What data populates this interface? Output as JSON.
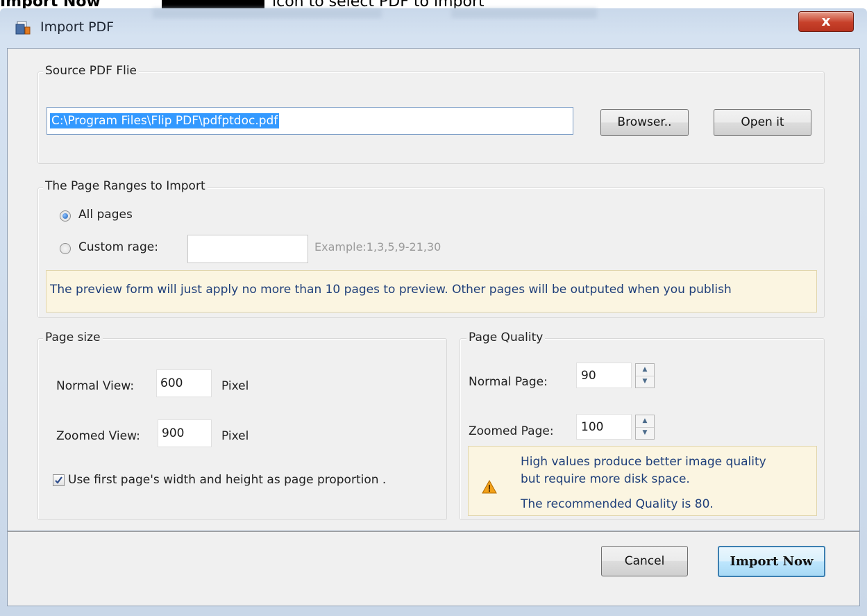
{
  "background": {
    "bold_text": "Import Now",
    "caption": "icon to select PDF to import"
  },
  "window": {
    "title": "Import PDF",
    "close_label": "x"
  },
  "source": {
    "legend": "Source PDF Flie",
    "path_value": "C:\\Program Files\\Flip PDF\\pdfptdoc.pdf",
    "browse_label": "Browser..",
    "open_label": "Open it"
  },
  "ranges": {
    "legend": "The Page Ranges to Import",
    "all_pages_label": "All pages",
    "all_pages_selected": true,
    "custom_label": "Custom rage:",
    "custom_value": "",
    "example_text": "Example:1,3,5,9-21,30",
    "info_text": "The preview form will just apply no more than 10 pages to preview. Other pages will be outputed when you publish"
  },
  "page_size": {
    "legend": "Page size",
    "normal_label": "Normal View:",
    "normal_value": "600",
    "zoomed_label": "Zoomed View:",
    "zoomed_value": "900",
    "unit": "Pixel",
    "proportion_label": "Use first page's width and height as page proportion .",
    "proportion_checked": true
  },
  "quality": {
    "legend": "Page Quality",
    "normal_label": "Normal Page:",
    "normal_value": "90",
    "zoomed_label": "Zoomed Page:",
    "zoomed_value": "100",
    "note_line1": "High values produce better image quality",
    "note_line2": "but require more disk space.",
    "note_line3": "The recommended Quality is 80."
  },
  "footer": {
    "cancel_label": "Cancel",
    "import_label": "Import Now"
  },
  "colors": {
    "selection": "#3399ff",
    "title_bar": "#c9d8ea",
    "close_button": "#c7402a",
    "note_background": "#fbf5e1",
    "import_button_border": "#3c7fb1"
  },
  "icons": [
    "app-pdf-icon",
    "close-icon",
    "warning-icon",
    "spin-up-icon",
    "spin-down-icon",
    "checkmark-icon"
  ]
}
